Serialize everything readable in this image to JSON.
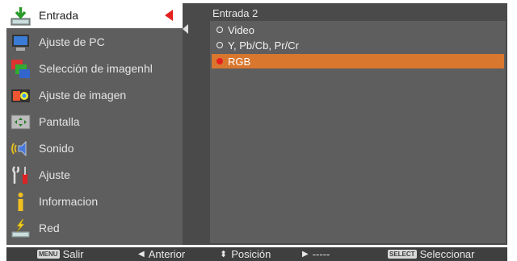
{
  "menu": {
    "items": [
      {
        "label": "Entrada",
        "icon": "input-icon",
        "active": true
      },
      {
        "label": "Ajuste de PC",
        "icon": "pc-adjust-icon"
      },
      {
        "label": "Selección de imagenhl",
        "icon": "image-select-icon"
      },
      {
        "label": "Ajuste de imagen",
        "icon": "image-adjust-icon"
      },
      {
        "label": "Pantalla",
        "icon": "screen-icon"
      },
      {
        "label": "Sonido",
        "icon": "sound-icon"
      },
      {
        "label": "Ajuste",
        "icon": "setting-icon"
      },
      {
        "label": "Informacion",
        "icon": "info-icon"
      },
      {
        "label": "Red",
        "icon": "network-icon"
      }
    ]
  },
  "panel": {
    "title": "Entrada 2",
    "options": [
      {
        "label": "Video",
        "selected": false
      },
      {
        "label": "Y, Pb/Cb, Pr/Cr",
        "selected": false
      },
      {
        "label": "RGB",
        "selected": true
      }
    ]
  },
  "footer": {
    "menu_key": "MENU",
    "menu_label": "Salir",
    "prev_label": "Anterior",
    "pos_label": "Posición",
    "next_label": "-----",
    "select_key": "SELECT",
    "select_label": "Seleccionar"
  },
  "colors": {
    "highlight": "#d9772f",
    "indicator": "#e6201d",
    "menu_bg": "#5e5e5e",
    "panel_bg": "#4a4a4a"
  }
}
